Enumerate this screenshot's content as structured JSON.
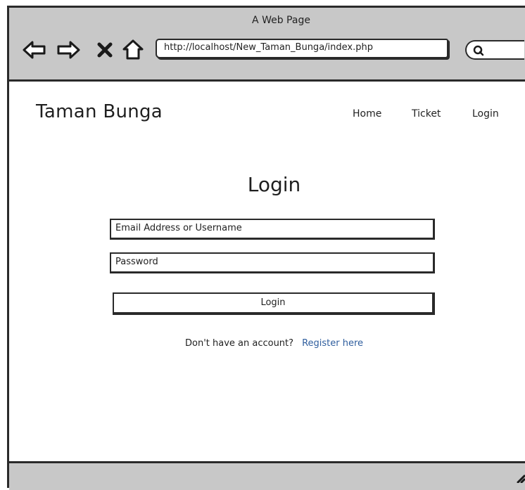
{
  "window": {
    "title": "A Web Page"
  },
  "browser": {
    "url": "http://localhost/New_Taman_Bunga/index.php",
    "buttons": {
      "back": "back-arrow-icon",
      "forward": "forward-arrow-icon",
      "stop": "close-x-icon",
      "home": "home-icon",
      "search": "search-icon"
    }
  },
  "navbar": {
    "brand": "Taman Bunga",
    "items": [
      {
        "label": "Home"
      },
      {
        "label": "Ticket"
      },
      {
        "label": "Login"
      }
    ]
  },
  "login": {
    "title": "Login",
    "email_value": "Email Address or Username",
    "password_value": "Password",
    "submit_label": "Login",
    "register_prompt": "Don't have an account?",
    "register_link": "Register here"
  },
  "colors": {
    "chrome": "#c8c8c8",
    "border": "#2a2a2a",
    "link": "#2f5e9e"
  }
}
